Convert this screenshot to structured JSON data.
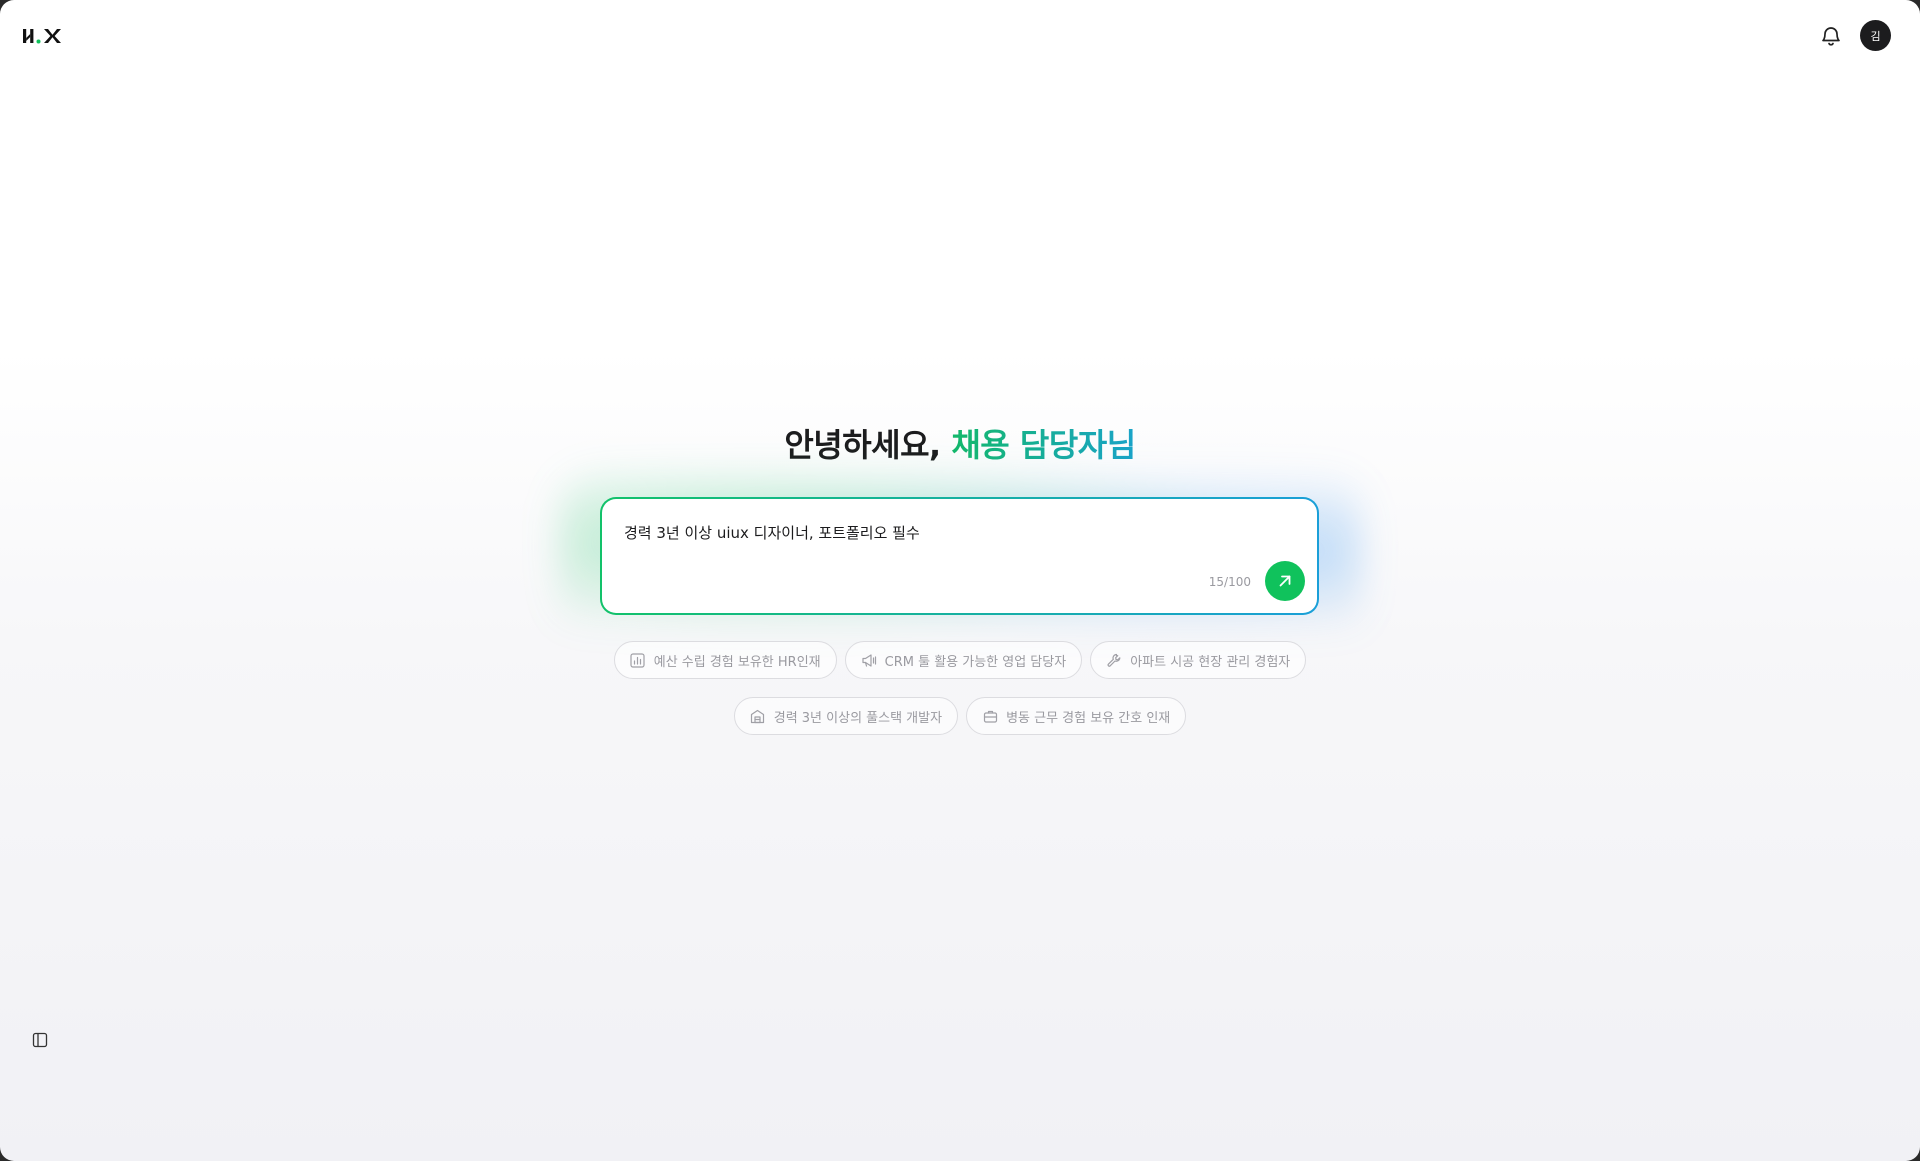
{
  "header": {
    "logo_text": "H.X",
    "avatar_initial": "김"
  },
  "greeting": {
    "text": "안녕하세요,",
    "accent": "채용 담당자님"
  },
  "prompt": {
    "value": "경력 3년 이상 uiux 디자이너, 포트폴리오 필수",
    "char_count": "15/100"
  },
  "suggestions": [
    {
      "label": "예산 수립 경험 보유한 HR인재",
      "icon": "bar-chart-icon"
    },
    {
      "label": "CRM 툴 활용 가능한 영업 담당자",
      "icon": "megaphone-icon"
    },
    {
      "label": "아파트 시공 현장 관리 경험자",
      "icon": "wrench-icon"
    },
    {
      "label": "경력 3년 이상의 풀스택 개발자",
      "icon": "building-icon"
    },
    {
      "label": "병동 근무 경험 보유 간호 인재",
      "icon": "briefcase-icon"
    }
  ],
  "colors": {
    "accent_green": "#10c25c",
    "accent_blue": "#1a9fd8"
  }
}
